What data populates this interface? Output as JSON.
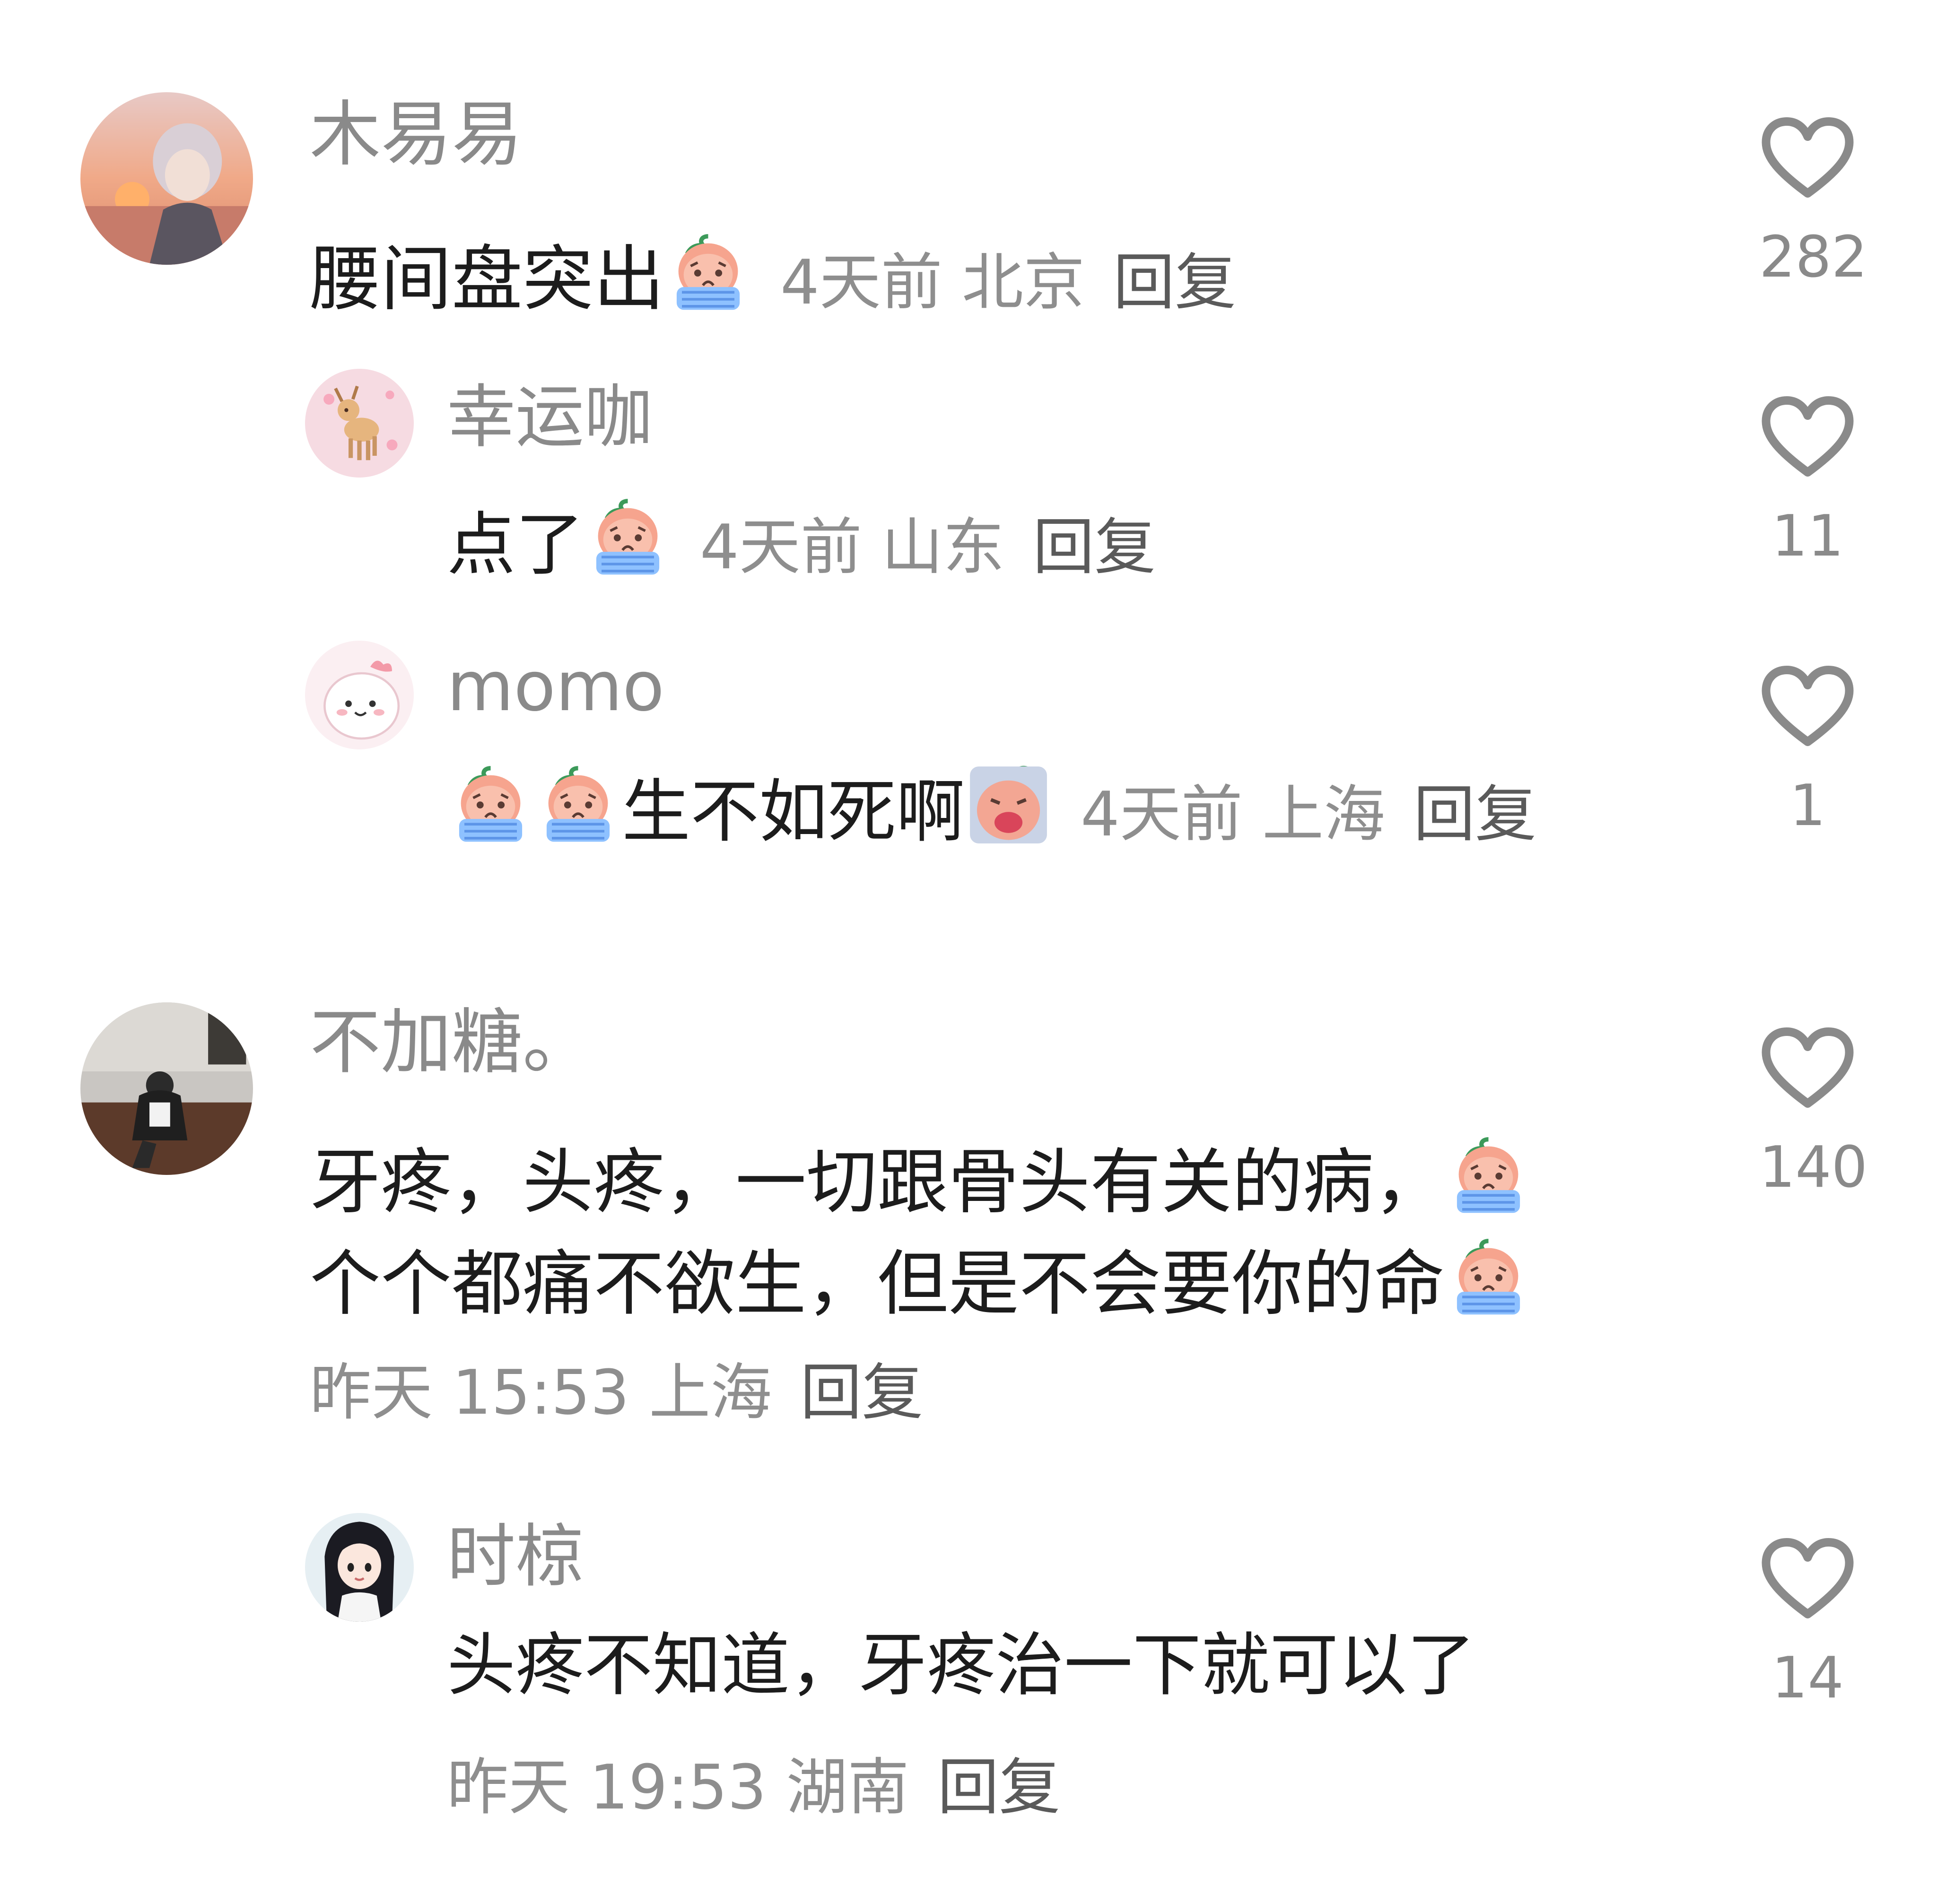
{
  "comments": [
    {
      "user": "木易易",
      "text_before": "腰间盘突出",
      "emoji_after": "crying-peach-emoji",
      "meta": "4天前 北京",
      "reply": "回复",
      "likes": "282"
    },
    {
      "user": "幸运咖",
      "text_before": "点了",
      "emoji_after": "crying-peach-emoji",
      "meta": "4天前 山东",
      "reply": "回复",
      "likes": "11"
    },
    {
      "user": "momo",
      "text_middle": "生不如死啊",
      "emojis_before": [
        "crying-peach-emoji",
        "crying-peach-emoji"
      ],
      "emoji_after": "screaming-peach-emoji",
      "meta": "4天前 上海",
      "reply": "回复",
      "likes": "1"
    },
    {
      "user": "不加糖。",
      "line1": "牙疼，头疼，一切跟骨头有关的病，",
      "line2": "个个都痛不欲生，但是不会要你的命",
      "meta": "昨天 15:53 上海",
      "reply": "回复",
      "likes": "140"
    },
    {
      "user": "时椋",
      "text": "头疼不知道，牙疼治一下就可以了",
      "meta": "昨天 19:53 湖南",
      "reply": "回复",
      "likes": "14"
    }
  ],
  "colors": {
    "username": "#8a8a8a",
    "text": "#1c1c1c",
    "meta": "#8e8e8e",
    "reply": "#5a5a5a",
    "heart": "#8a8a8a"
  }
}
